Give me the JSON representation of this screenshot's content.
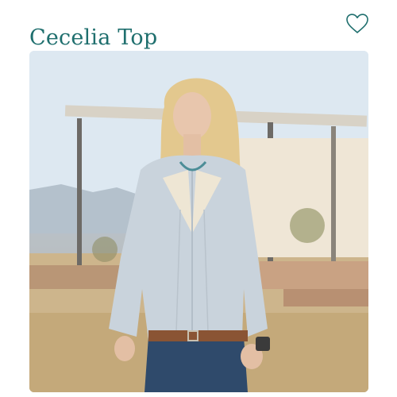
{
  "product": {
    "title": "Cecelia Top"
  },
  "icons": {
    "favorite": "heart-outline-icon"
  },
  "colors": {
    "brand_teal": "#1f6f6e"
  }
}
